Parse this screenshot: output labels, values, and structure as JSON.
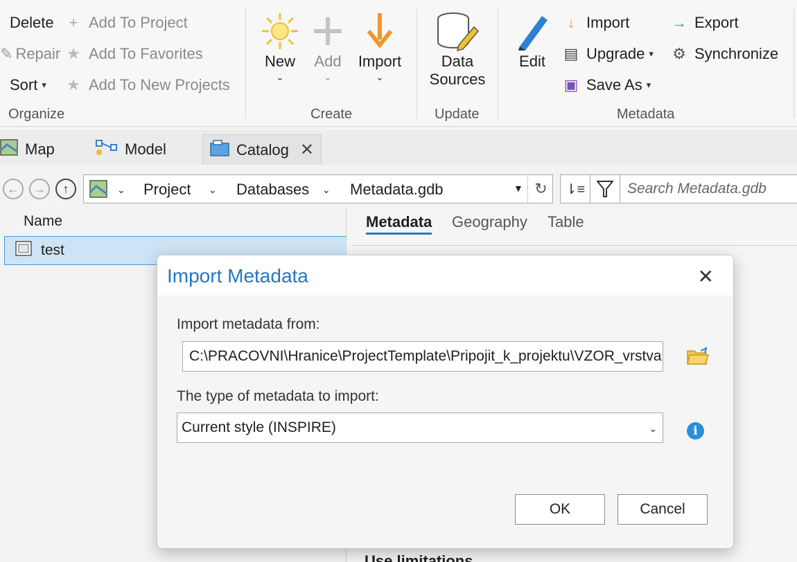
{
  "ribbon": {
    "organize": {
      "label": "Organize",
      "delete": "Delete",
      "repair": "Repair",
      "sort": "Sort",
      "add_to_project": "Add To Project",
      "add_to_favorites": "Add To Favorites",
      "add_to_new_projects": "Add To New Projects"
    },
    "create": {
      "label": "Create",
      "new": "New",
      "add": "Add",
      "import": "Import"
    },
    "update": {
      "label": "Update",
      "data_sources_1": "Data",
      "data_sources_2": "Sources"
    },
    "metadata": {
      "label": "Metadata",
      "edit": "Edit",
      "import": "Import",
      "upgrade": "Upgrade",
      "save_as": "Save As",
      "export": "Export",
      "synchronize": "Synchronize"
    }
  },
  "tabs": [
    {
      "label": "Map"
    },
    {
      "label": "Model"
    },
    {
      "label": "Catalog"
    }
  ],
  "address": {
    "crumbs": [
      "Project",
      "Databases",
      "Metadata.gdb"
    ],
    "search_placeholder": "Search Metadata.gdb"
  },
  "left_pane": {
    "column_header": "Name",
    "items": [
      {
        "label": "test"
      }
    ]
  },
  "right_pane": {
    "tabs": [
      "Metadata",
      "Geography",
      "Table"
    ],
    "partial_heading": "Use limitations"
  },
  "dialog": {
    "title": "Import Metadata",
    "from_label": "Import metadata from:",
    "from_value": "C:\\PRACOVNI\\Hranice\\ProjectTemplate\\Pripojit_k_projektu\\VZOR_vrstva",
    "type_label": "The type of metadata to import:",
    "type_value": "Current style (INSPIRE)",
    "ok": "OK",
    "cancel": "Cancel"
  },
  "colors": {
    "accent": "#2676c0",
    "selection": "#cde4f7",
    "import_arrow": "#f0962a",
    "export_arrow": "#3aa54a"
  }
}
